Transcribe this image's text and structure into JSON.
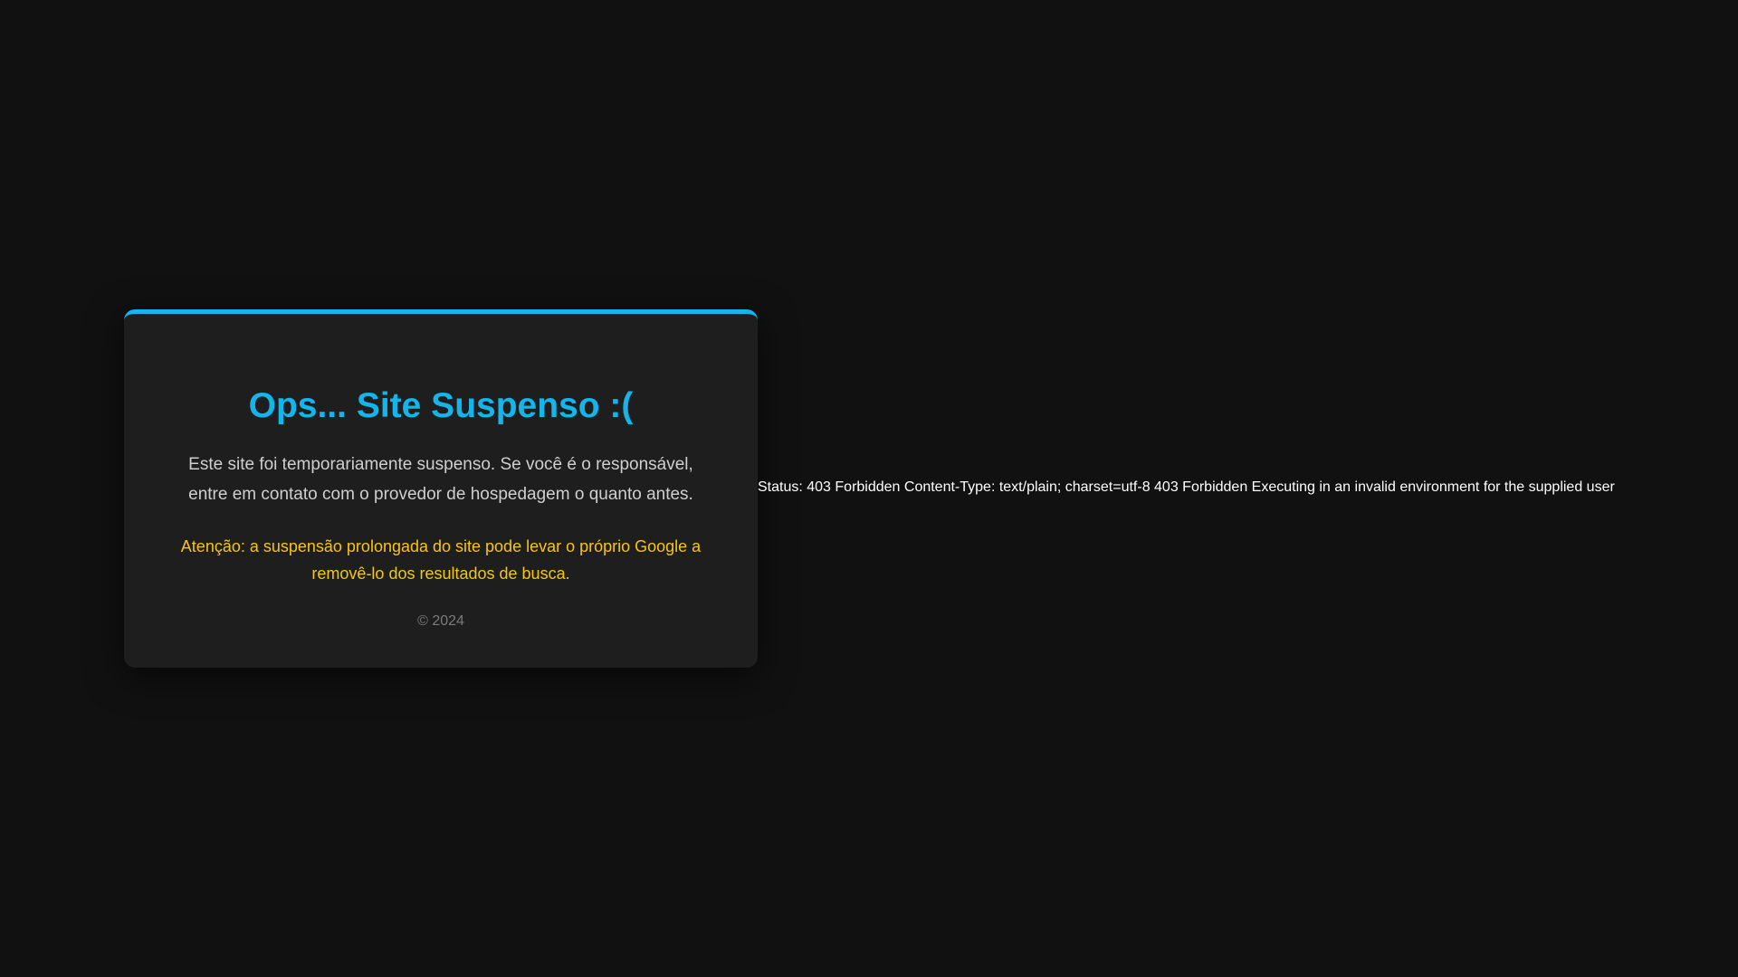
{
  "card": {
    "title": "Ops... Site Suspenso :(",
    "message": "Este site foi temporariamente suspenso. Se você é o responsável, entre em contato com o provedor de hospedagem o quanto antes.",
    "warning": "Atenção: a suspensão prolongada do site pode levar o próprio Google a removê-lo dos resultados de busca.",
    "footer": "© 2024"
  },
  "status_text": "Status: 403 Forbidden Content-Type: text/plain; charset=utf-8 403 Forbidden Executing in an invalid environment for the supplied user",
  "colors": {
    "background": "#111111",
    "card_background": "#1e1e1e",
    "accent": "#13b5ea",
    "message_text": "#cfcfcf",
    "warning_text": "#f5c518",
    "footer_text": "#7b7b7b",
    "status_text": "#ffffff"
  }
}
